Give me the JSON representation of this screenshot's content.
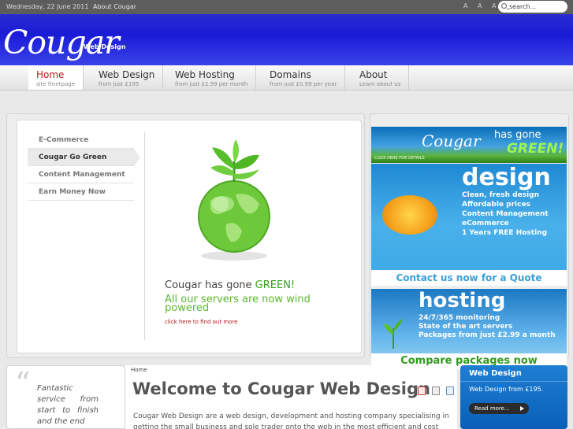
{
  "topbar": {
    "date": "Wednesday, 22 June 2011",
    "separator": "|",
    "about_link": "About Cougar",
    "font_sizes": "A A A",
    "search_placeholder": "search..."
  },
  "header": {
    "logo": "Cougar",
    "logo_sub": "Web Design",
    "bg_color": "#1a1bd6"
  },
  "nav": {
    "items": [
      {
        "label": "Home",
        "sub": "site frontpage"
      },
      {
        "label": "Web Design",
        "sub": "from just £195"
      },
      {
        "label": "Web Hosting",
        "sub": "from just £2.99 per month"
      },
      {
        "label": "Domains",
        "sub": "from just £0.99 per year"
      },
      {
        "label": "About",
        "sub": "Learn about us"
      }
    ]
  },
  "slider": {
    "tabs": [
      "E-Commerce",
      "Cougar Go Green",
      "Content Management",
      "Earn Money Now"
    ],
    "title_prefix": "Cougar has gone ",
    "title_highlight": "GREEN!",
    "subtitle": "All our servers are now wind powered",
    "link": "click here to find out more"
  },
  "promo": {
    "green_banner": {
      "brand": "Cougar",
      "has_gone": "has gone",
      "green": "GREEN!",
      "details": "CLICK HERE FOR DETAILS"
    },
    "design_banner": {
      "headline": "design",
      "lines": [
        "Clean, fresh design",
        "Affordable prices",
        "Content Management",
        "eCommerce",
        "1 Years FREE Hosting"
      ],
      "cta": "Contact us now for a Quote"
    },
    "hosting_banner": {
      "headline": "hosting",
      "lines": [
        "24/7/365 monitoring",
        "State of the art servers",
        "Packages from just £2.99 a month"
      ],
      "cta": "Compare packages now"
    }
  },
  "quote": {
    "mark": "“",
    "text": "Fantastic service from start to finish and the end"
  },
  "content": {
    "breadcrumb": "Home",
    "title": "Welcome to Cougar Web Design",
    "paragraph": "Cougar Web Design are a web design, development and hosting company specialising in getting the small business and sole trader onto the web in the most efficient and cost effective manner"
  },
  "sidebox": {
    "title": "Web Design",
    "text": "Web Design from £195.",
    "button": "Read more..."
  }
}
